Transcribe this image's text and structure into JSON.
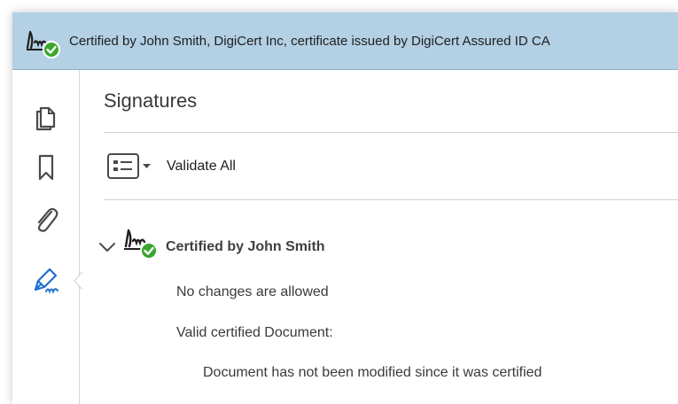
{
  "banner": {
    "text": "Certified by John Smith, DigiCert Inc, certificate issued by DigiCert Assured ID CA",
    "icon": "signature-certified-icon"
  },
  "nav": {
    "items": [
      {
        "name": "page-thumbnails",
        "icon": "pages-icon"
      },
      {
        "name": "bookmarks",
        "icon": "bookmark-icon"
      },
      {
        "name": "attachments",
        "icon": "paperclip-icon"
      },
      {
        "name": "signatures",
        "icon": "signature-pen-icon",
        "active": true
      }
    ]
  },
  "panel": {
    "title": "Signatures",
    "validate_all_label": "Validate All",
    "signature": {
      "title": "Certified by John Smith",
      "details": [
        "No changes are allowed",
        "Valid certified Document:",
        "Document has not been modified since it was certified"
      ]
    }
  },
  "colors": {
    "banner_bg": "#b3d0e4",
    "check_green": "#3aa62f",
    "active_icon_blue": "#1e6fd0"
  }
}
